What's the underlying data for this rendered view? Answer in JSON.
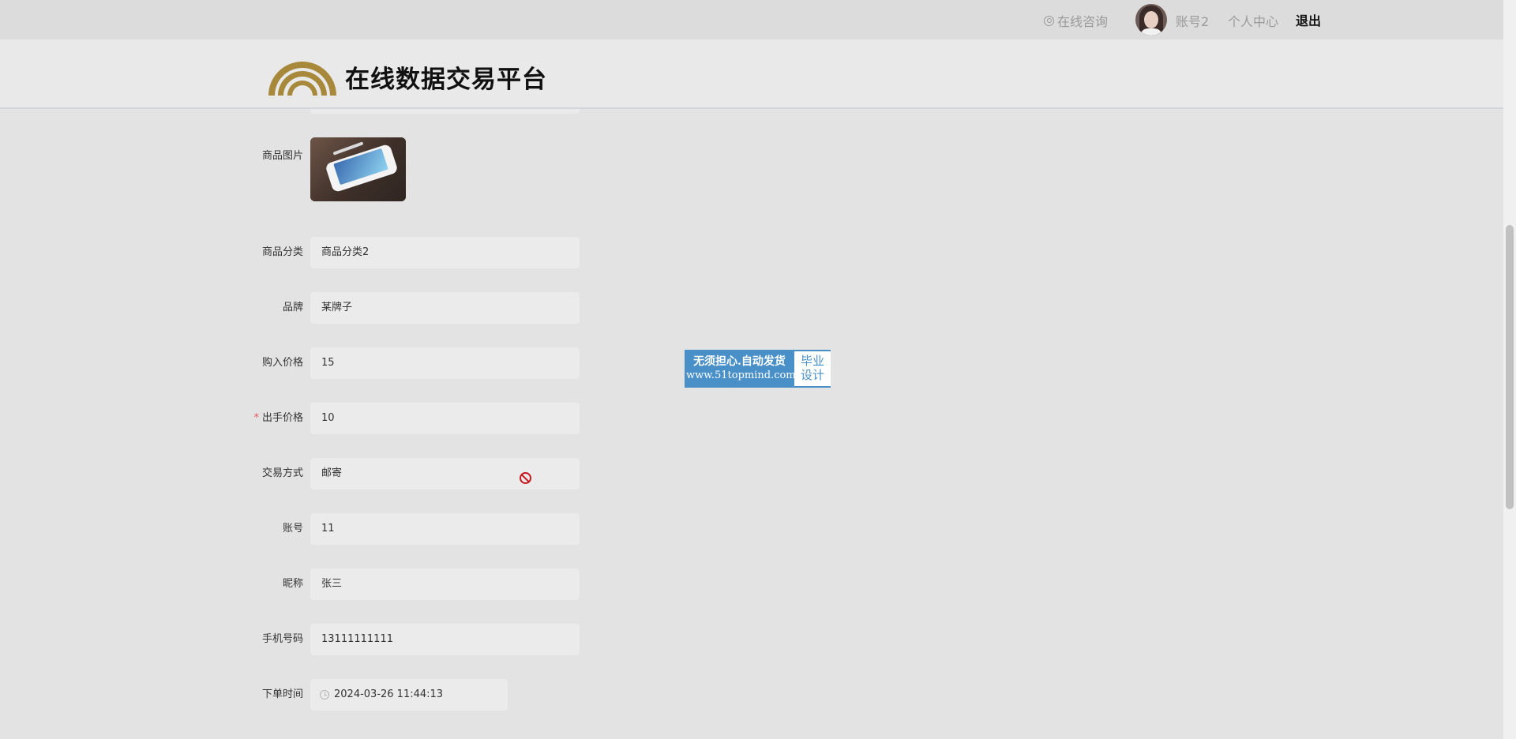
{
  "topbar": {
    "consult_label": "在线咨询",
    "account_label": "账号2",
    "personal_center_label": "个人中心",
    "logout_label": "退出"
  },
  "header": {
    "title": "在线数据交易平台",
    "logo_icon": "arc-logo-icon",
    "logo_color": "#a8883b"
  },
  "form": {
    "image_label": "商品图片",
    "fields": [
      {
        "label": "商品分类",
        "value": "商品分类2",
        "required": false
      },
      {
        "label": "品牌",
        "value": "某牌子",
        "required": false
      },
      {
        "label": "购入价格",
        "value": "15",
        "required": false
      },
      {
        "label": "出手价格",
        "value": "10",
        "required": true
      },
      {
        "label": "交易方式",
        "value": "邮寄",
        "required": false
      },
      {
        "label": "账号",
        "value": "11",
        "required": false
      },
      {
        "label": "昵称",
        "value": "张三",
        "required": false
      },
      {
        "label": "手机号码",
        "value": "13111111111",
        "required": false
      },
      {
        "label": "下单时间",
        "value": "2024-03-26 11:44:13",
        "required": false
      }
    ],
    "required_mark": "*"
  },
  "ad": {
    "line1": "无须担心.自动发货",
    "line2": "www.51topmind.com",
    "right_line1": "毕业",
    "right_line2": "设计"
  },
  "colors": {
    "background": "#e3e3e3",
    "required": "#e45656",
    "ad_blue": "#4a90c8",
    "no_entry": "#c4161c"
  }
}
